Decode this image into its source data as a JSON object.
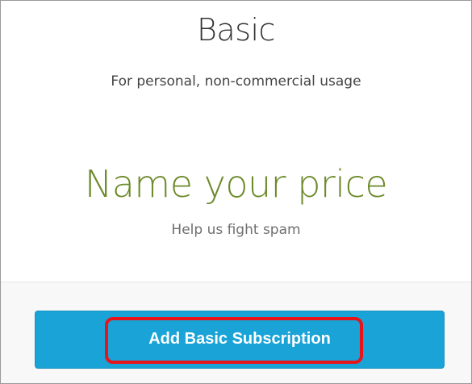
{
  "plan": {
    "title": "Basic",
    "subtitle": "For personal, non-commercial usage",
    "price": "Name your price",
    "price_note": "Help us fight spam"
  },
  "action": {
    "button_label": "Add Basic Subscription"
  },
  "colors": {
    "price_green": "#6c8a2a",
    "button_blue": "#1aa3d6",
    "highlight_red": "#e8141c"
  }
}
